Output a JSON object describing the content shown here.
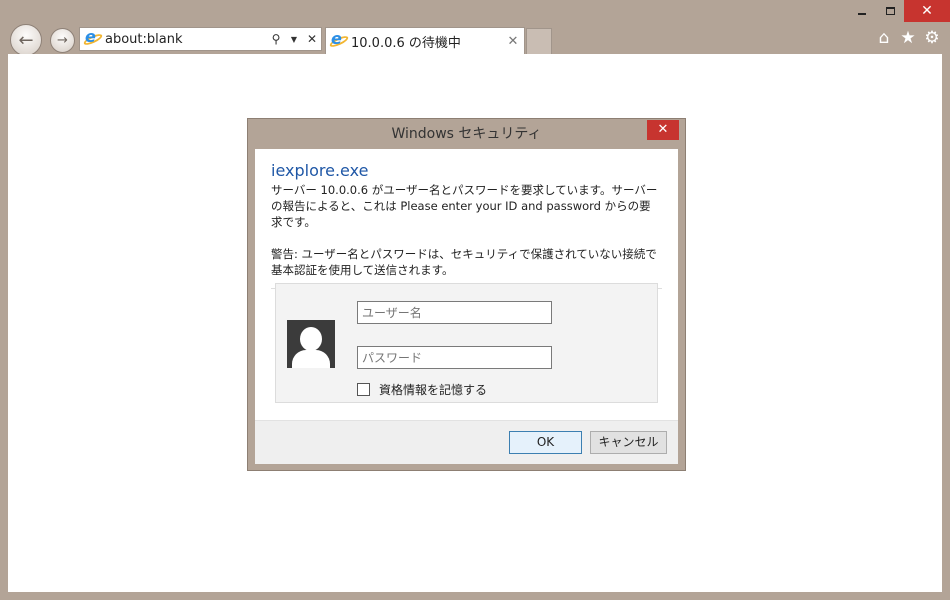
{
  "browser": {
    "address": {
      "value": "about:blank"
    },
    "tab": {
      "title": "10.0.0.6 の待機中"
    }
  },
  "dialog": {
    "title": "Windows セキュリティ",
    "app_name": "iexplore.exe",
    "message": "サーバー 10.0.0.6 がユーザー名とパスワードを要求しています。サーバーの報告によると、これは Please enter your ID and password からの要求です。",
    "warning": "警告: ユーザー名とパスワードは、セキュリティで保護されていない接続で基本認証を使用して送信されます。",
    "username": {
      "value": "",
      "placeholder": "ユーザー名"
    },
    "password": {
      "value": "",
      "placeholder": "パスワード"
    },
    "remember_label": "資格情報を記憶する",
    "remember_checked": false,
    "ok_label": "OK",
    "cancel_label": "キャンセル"
  },
  "colors": {
    "frame": "#b3a497",
    "close_red": "#c7342f",
    "app_name_blue": "#1f57a6"
  },
  "icons": {
    "back": "arrow-left-icon",
    "forward": "arrow-right-icon",
    "home": "home-icon",
    "favorites": "star-icon",
    "tools": "gear-icon",
    "user": "user-avatar-icon"
  }
}
